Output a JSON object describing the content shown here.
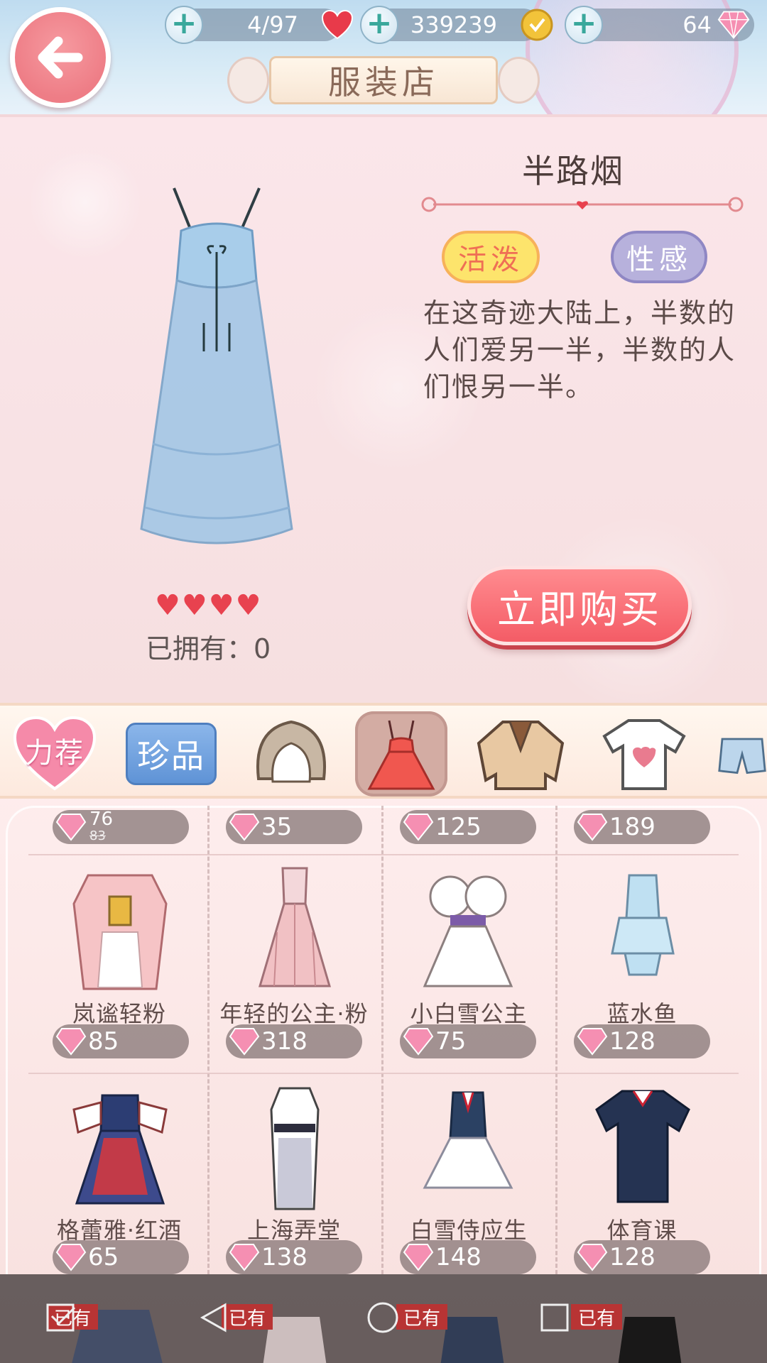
{
  "header": {
    "title": "服装店",
    "stamina": "4/97",
    "coins": "339239",
    "diamonds": "64"
  },
  "detail": {
    "name": "半路烟",
    "tags": [
      "活泼",
      "性感"
    ],
    "description": "在这奇迹大陆上，半数的人们爱另一半，半数的人们恨另一半。",
    "rating_hearts": 4,
    "owned_label": "已拥有：0",
    "buy_label": "立即购买"
  },
  "categories": [
    {
      "name": "recommend",
      "label": "力荐"
    },
    {
      "name": "rare",
      "label": "珍品"
    },
    {
      "name": "hair",
      "label": ""
    },
    {
      "name": "dress",
      "label": "",
      "active": true
    },
    {
      "name": "coat",
      "label": ""
    },
    {
      "name": "top",
      "label": ""
    },
    {
      "name": "bottom",
      "label": ""
    }
  ],
  "items_top_row": [
    {
      "price": "76",
      "old_price": "83"
    },
    {
      "price": "35"
    },
    {
      "price": "125"
    },
    {
      "price": "189"
    }
  ],
  "items": [
    {
      "label": "岚谧轻粉",
      "price": "85"
    },
    {
      "label": "年轻的公主·粉",
      "price": "318"
    },
    {
      "label": "小白雪公主",
      "price": "75"
    },
    {
      "label": "蓝水鱼",
      "price": "128"
    },
    {
      "label": "格蕾雅·红酒",
      "price": "65"
    },
    {
      "label": "上海弄堂",
      "price": "138"
    },
    {
      "label": "白雪侍应生",
      "price": "148"
    },
    {
      "label": "体育课",
      "price": "128"
    }
  ],
  "bottom_row": [
    {
      "tag": "已有"
    },
    {
      "tag": "已有"
    },
    {
      "tag": "已有"
    },
    {
      "tag": "已有"
    }
  ],
  "colors": {
    "accent": "#f45c66",
    "heart": "#e8424f",
    "price_pill": "#807070"
  }
}
